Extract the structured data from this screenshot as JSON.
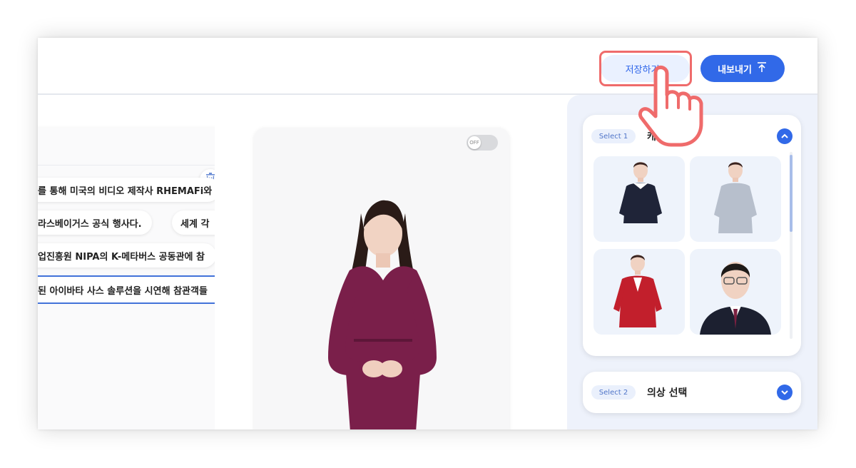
{
  "toolbar": {
    "save_label": "저장하기",
    "export_label": "내보내기"
  },
  "script": {
    "lines": [
      "를 통해 미국의 비디오 제작사 RHEMAFi와",
      "라스베이거스 공식 행사다.",
      "세계 각",
      "업진흥원 NIPA의 K-메타버스 공동관에 참",
      "된 아이바타 사스 솔루션을 시연해 참관객들"
    ]
  },
  "preview": {
    "toggle_label": "OFF"
  },
  "panel": {
    "select1": {
      "badge": "Select 1",
      "title": "캐릭"
    },
    "select2": {
      "badge": "Select 2",
      "title": "의상 선택"
    }
  },
  "colors": {
    "accent": "#3169e8",
    "highlight": "#ef6b6b",
    "panel_bg": "#eef2fb"
  },
  "icons": [
    "trash-icon",
    "export-icon",
    "chevron-up-icon",
    "chevron-down-icon",
    "pointer-hand-icon"
  ]
}
